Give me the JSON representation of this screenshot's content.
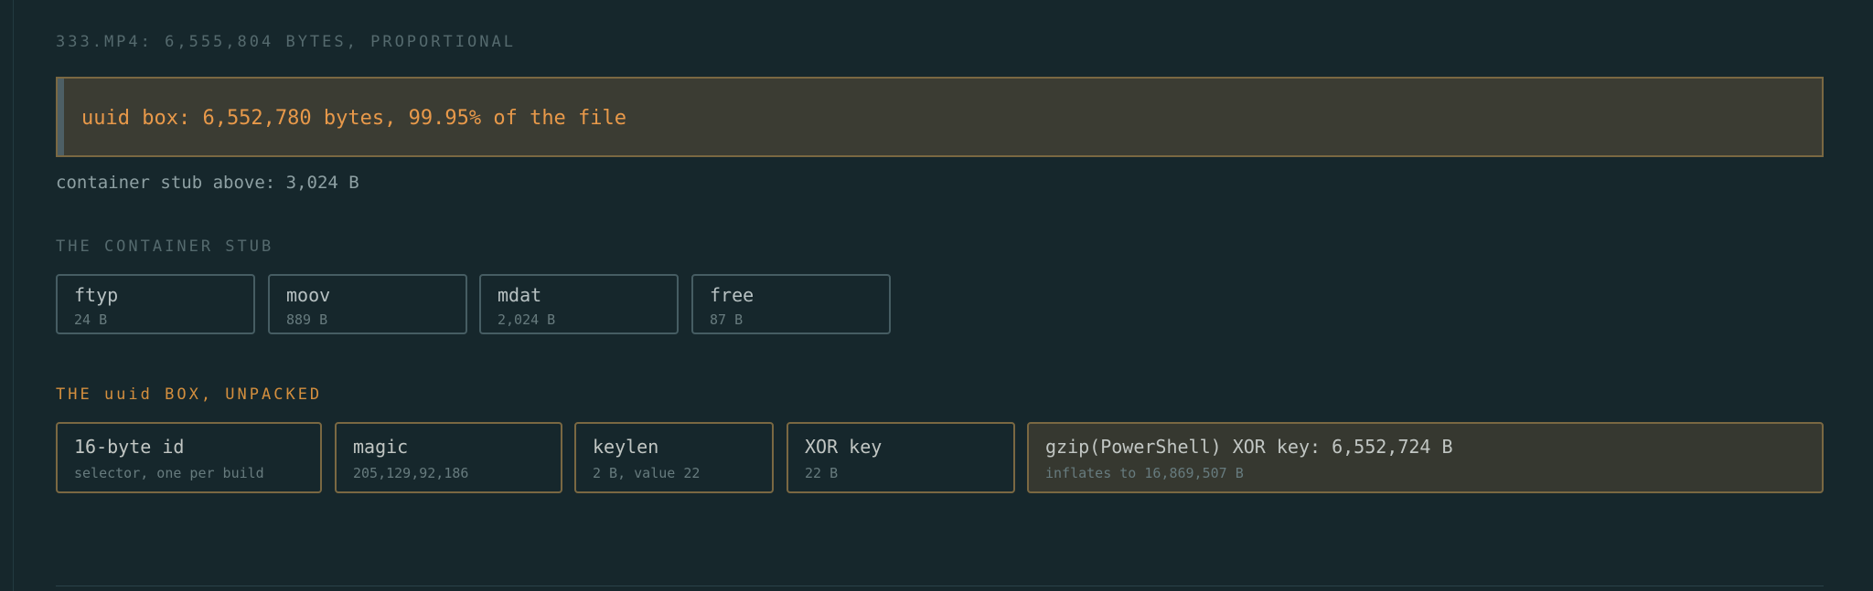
{
  "file": {
    "title": "333.MP4: 6,555,804 BYTES, PROPORTIONAL",
    "uuid_label": "uuid box: 6,552,780 bytes, 99.95% of the file",
    "stub_note": "container stub above: 3,024 B"
  },
  "stub": {
    "title": "THE CONTAINER STUB",
    "boxes": [
      {
        "name": "ftyp",
        "size": "24 B"
      },
      {
        "name": "moov",
        "size": "889 B"
      },
      {
        "name": "mdat",
        "size": "2,024 B"
      },
      {
        "name": "free",
        "size": "87 B"
      }
    ]
  },
  "uuid": {
    "title": "THE uuid BOX, UNPACKED",
    "fields": [
      {
        "name": "16-byte id",
        "detail": "selector, one per build"
      },
      {
        "name": "magic",
        "detail": "205,129,92,186"
      },
      {
        "name": "keylen",
        "detail": "2 B, value 22"
      },
      {
        "name": "XOR key",
        "detail": "22 B"
      },
      {
        "name": "gzip(PowerShell) XOR key: 6,552,724 B",
        "detail": "inflates to 16,869,507 B"
      }
    ]
  },
  "proportion": {
    "total_bytes": 6555804,
    "uuid_bytes": 6552780,
    "stub_bytes": 3024
  },
  "colors": {
    "background": "#16272c",
    "accent": "#e8994a",
    "uuid_border": "#7a6842",
    "stub_border": "#465d63"
  }
}
